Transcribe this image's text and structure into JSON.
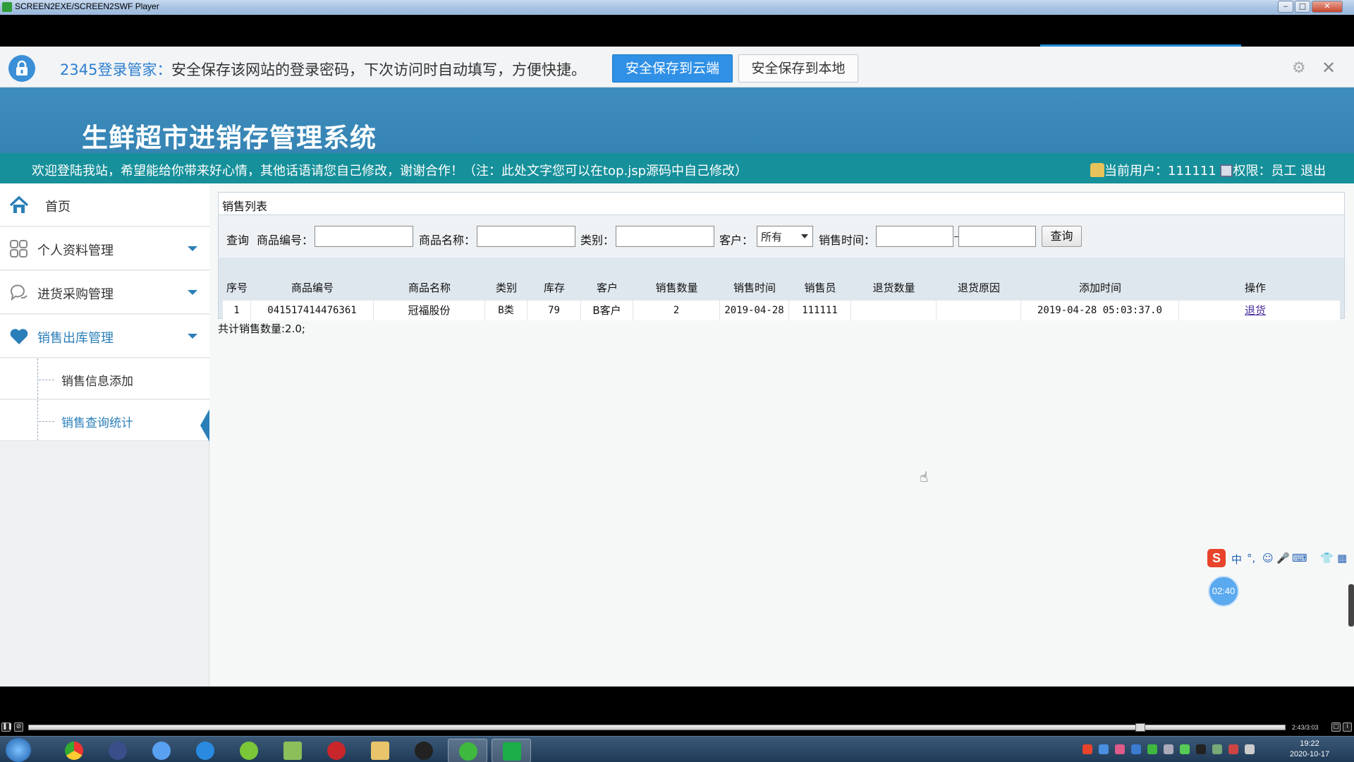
{
  "window": {
    "title": "SCREEN2EXE/SCREEN2SWF Player"
  },
  "password_bar": {
    "brand": "2345登录管家：",
    "message": "安全保存该网站的登录密码，下次访问时自动填写，方便快捷。",
    "save_cloud": "安全保存到云端",
    "save_local": "安全保存到本地"
  },
  "site": {
    "title": "生鲜超市进销存管理系统",
    "notice": "欢迎登陆我站，希望能给你带来好心情，其他话语请您自己修改，谢谢合作！（注：此处文字您可以在top.jsp源码中自己修改）",
    "current_user_label": "当前用户：",
    "current_user": "111111",
    "role_label": "权限：",
    "role": "员工",
    "logout": "退出"
  },
  "sidebar": {
    "home": "首页",
    "menus": [
      {
        "label": "个人资料管理"
      },
      {
        "label": "进货采购管理"
      },
      {
        "label": "销售出库管理"
      }
    ],
    "sub_items": [
      {
        "label": "销售信息添加"
      },
      {
        "label": "销售查询统计"
      }
    ]
  },
  "panel": {
    "title": "销售列表",
    "search": {
      "query_label": "查询",
      "code_label": "商品编号：",
      "code_value": "",
      "name_label": "商品名称：",
      "name_value": "",
      "category_label": "类别：",
      "category_value": "",
      "customer_label": "客户：",
      "customer_selected": "所有",
      "time_label": "销售时间：",
      "time_from": "",
      "time_to": "",
      "button": "查询"
    },
    "columns": [
      "序号",
      "商品编号",
      "商品名称",
      "类别",
      "库存",
      "客户",
      "销售数量",
      "销售时间",
      "销售员",
      "退货数量",
      "退货原因",
      "添加时间",
      "操作"
    ],
    "rows": [
      {
        "seq": "1",
        "code": "041517414476361",
        "name": "冠福股份",
        "category": "B类",
        "stock": "79",
        "customer": "B客户",
        "qty": "2",
        "sale_date": "2019-04-28",
        "seller": "111111",
        "return_qty": "",
        "return_reason": "",
        "added": "2019-04-28 05:03:37.0",
        "action": "退货"
      }
    ],
    "total": "共计销售数量:2.0;"
  },
  "overlays": {
    "ime_items": [
      "中",
      "°,",
      "☺",
      "🎤",
      "⌨",
      "👕",
      "▦"
    ],
    "timer": "02:40"
  },
  "player": {
    "time": "2:43/3:03"
  },
  "taskbar": {
    "time": "19:22",
    "date": "2020-10-17"
  }
}
